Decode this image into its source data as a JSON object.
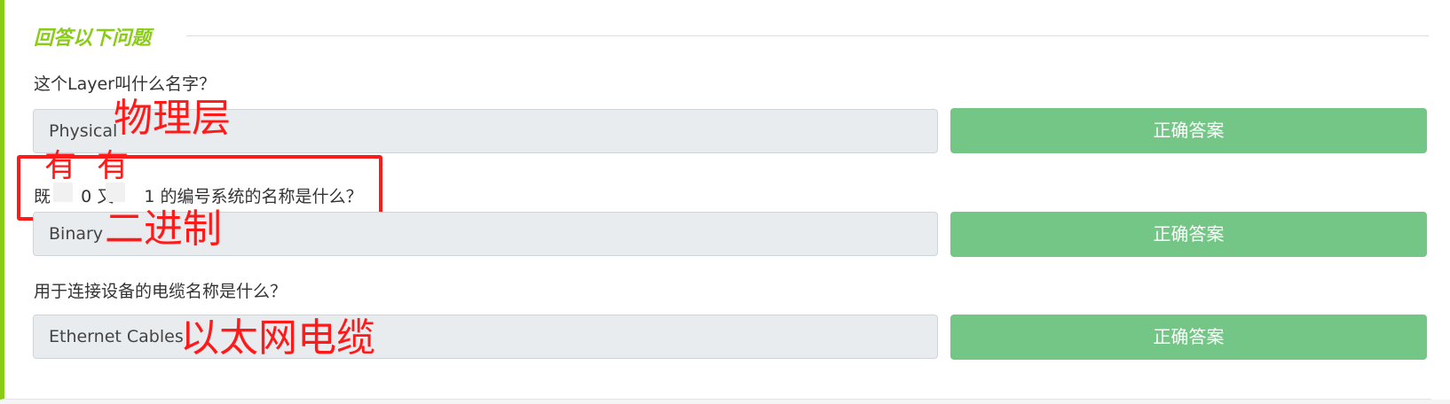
{
  "section": {
    "title": "回答以下问题"
  },
  "questions": [
    {
      "text": "这个Layer叫什么名字？",
      "answer": "Physical",
      "button": "正确答案",
      "annotation": "物理层"
    },
    {
      "text_parts": [
        "既",
        "0",
        "又",
        "1",
        "的编号系统的名称是什么？"
      ],
      "answer": "Binary",
      "button": "正确答案",
      "annotation": "二进制",
      "inline_annotations": [
        "有",
        "有"
      ]
    },
    {
      "text": "用于连接设备的电缆名称是什么？",
      "answer": "Ethernet Cables",
      "button": "正确答案",
      "annotation": "以太网电缆"
    }
  ],
  "colors": {
    "accent": "#88cc14",
    "button": "#74c686",
    "annotation": "#ff1a1a"
  }
}
